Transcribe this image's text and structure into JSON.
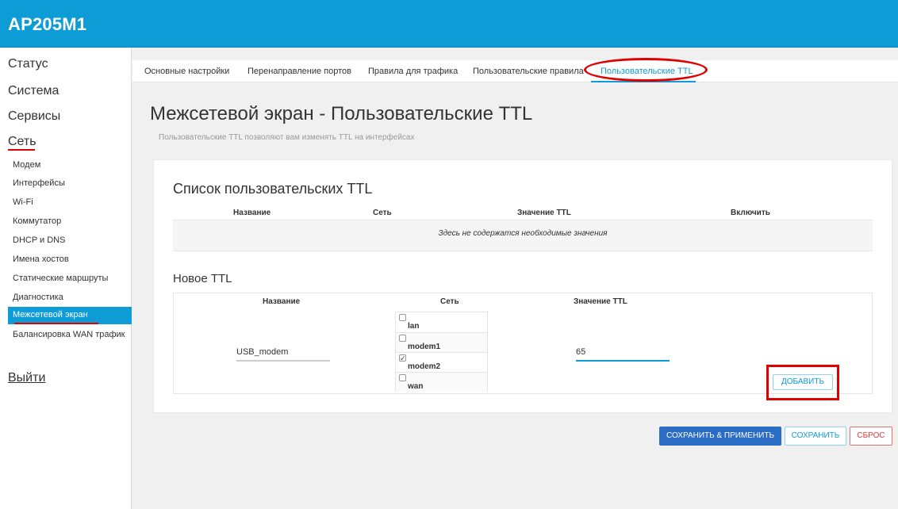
{
  "header": {
    "brand": "AP205M1"
  },
  "sidebar": {
    "top_items": [
      "Статус",
      "Система",
      "Сервисы",
      "Сеть"
    ],
    "sub_items": [
      "Модем",
      "Интерфейсы",
      "Wi-Fi",
      "Коммутатор",
      "DHCP и DNS",
      "Имена хостов",
      "Статические маршруты",
      "Диагностика",
      "Межсетевой экран",
      "Балансировка WAN трафик"
    ],
    "logout": "Выйти"
  },
  "tabs": [
    "Основные настройки",
    "Перенаправление портов",
    "Правила для трафика",
    "Пользовательские правила",
    "Пользовательские TTL"
  ],
  "page": {
    "title": "Межсетевой экран - Пользовательские TTL",
    "description": "Пользовательские TTL позволяют вам изменять TTL на интерфейсах"
  },
  "list": {
    "title": "Список пользовательских TTL",
    "headers": [
      "Название",
      "Сеть",
      "Значение TTL",
      "Включить"
    ],
    "empty_text": "Здесь не содержатся необходимые значения"
  },
  "new_ttl": {
    "title": "Новое TTL",
    "headers": [
      "Название",
      "Сеть",
      "Значение TTL"
    ],
    "name_value": "USB_modem",
    "networks": [
      {
        "label": "lan",
        "checked": false
      },
      {
        "label": "modem1",
        "checked": false
      },
      {
        "label": "modem2",
        "checked": true
      },
      {
        "label": "wan",
        "checked": false
      }
    ],
    "ttl_value": "65",
    "add_button": "ДОБАВИТЬ"
  },
  "actions": {
    "save_apply": "СОХРАНИТЬ & ПРИМЕНИТЬ",
    "save": "СОХРАНИТЬ",
    "reset": "СБРОС"
  },
  "colors": {
    "header_bg": "#0e9cd7",
    "active_blue": "#0e9cd7",
    "primary_button": "#2b6cc4",
    "highlight_red": "#e10000"
  }
}
